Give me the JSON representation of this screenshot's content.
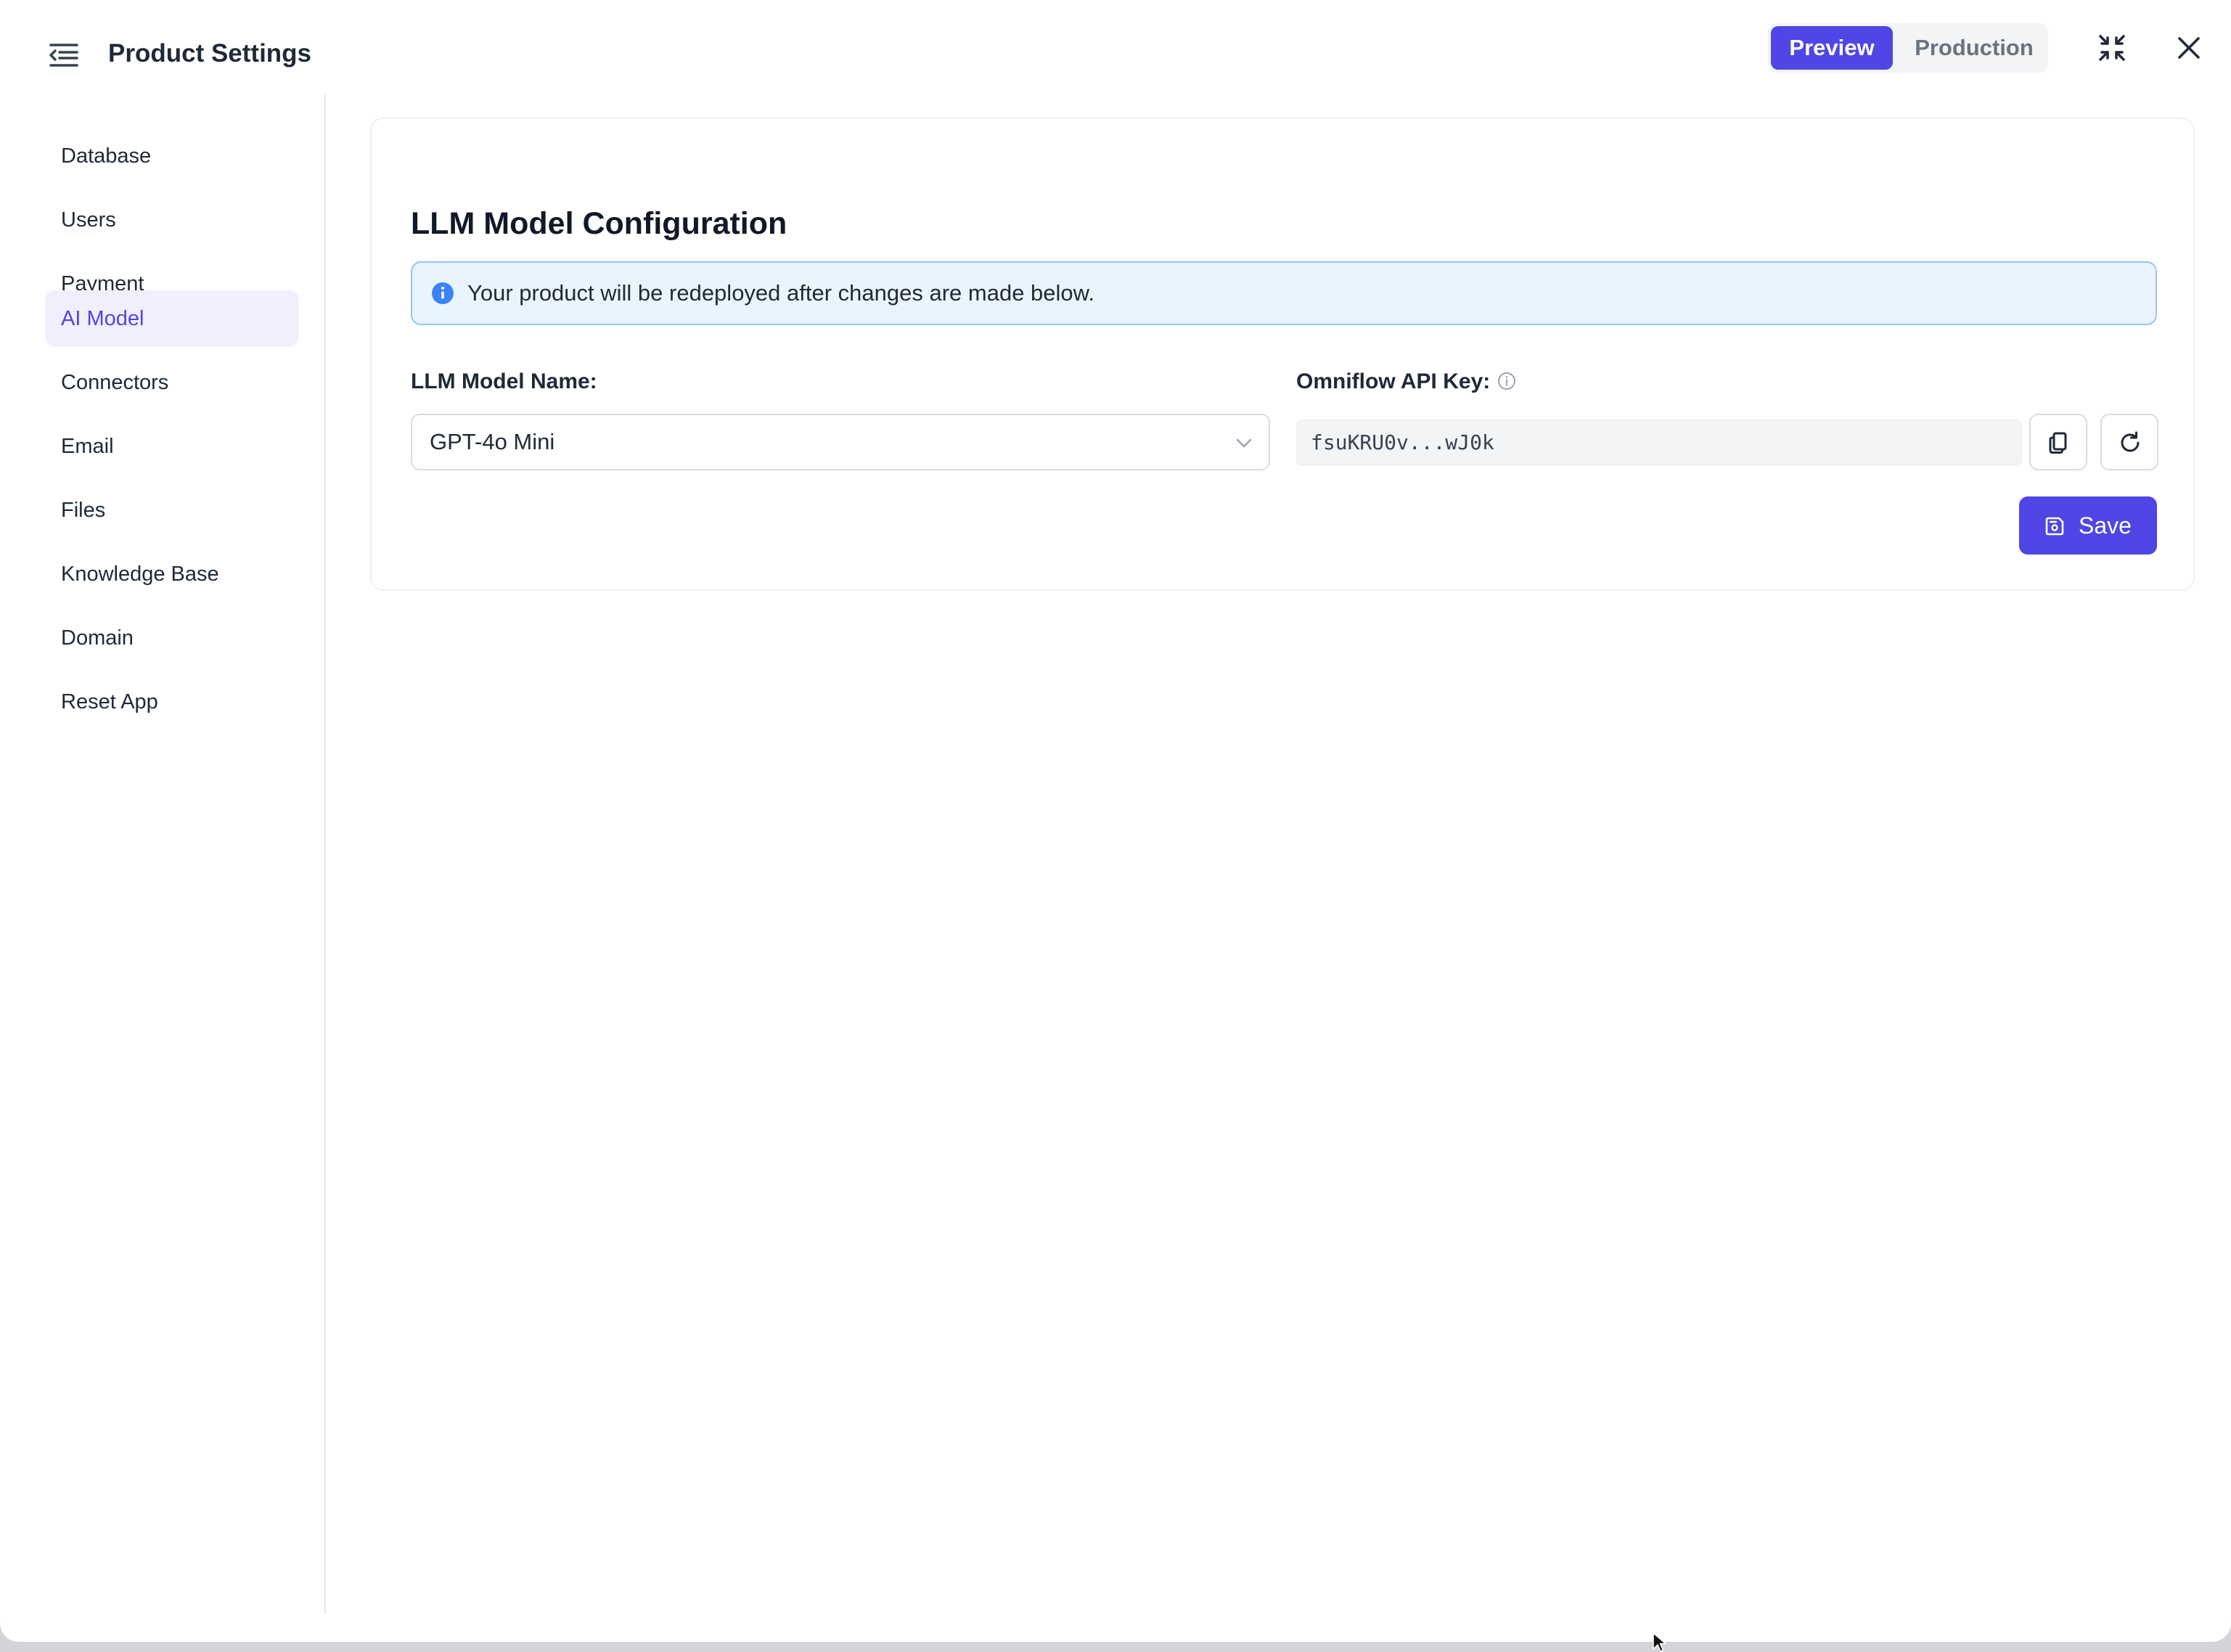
{
  "header": {
    "title": "Product Settings",
    "environments": [
      "Preview",
      "Production"
    ],
    "active_environment": "Preview"
  },
  "sidebar": {
    "items": [
      {
        "label": "Database"
      },
      {
        "label": "Users"
      },
      {
        "label": "Payment"
      },
      {
        "label": "AI Model",
        "active": true
      },
      {
        "label": "Connectors"
      },
      {
        "label": "Email"
      },
      {
        "label": "Files"
      },
      {
        "label": "Knowledge Base"
      },
      {
        "label": "Domain"
      },
      {
        "label": "Reset App"
      }
    ]
  },
  "main": {
    "section_title": "LLM Model Configuration",
    "info_banner": "Your product will be redeployed after changes are made below.",
    "model_field": {
      "label": "LLM Model Name:",
      "selected": "GPT-4o Mini"
    },
    "api_key_field": {
      "label": "Omniflow API Key:",
      "value": "fsuKRU0v...wJ0k"
    },
    "save_label": "Save"
  },
  "colors": {
    "accent": "#4f46e5",
    "active_nav_bg": "#f1eefd",
    "info_bg": "#eaf4ff",
    "info_border": "#93c5fd",
    "info_icon": "#3b82f6"
  },
  "icons": {
    "menu": "menu-collapse-icon",
    "collapse": "collapse-arrows-icon",
    "close": "close-icon",
    "info": "info-circle-icon",
    "chevron": "chevron-down-icon",
    "copy": "copy-icon",
    "regenerate": "refresh-icon",
    "save": "save-icon"
  }
}
